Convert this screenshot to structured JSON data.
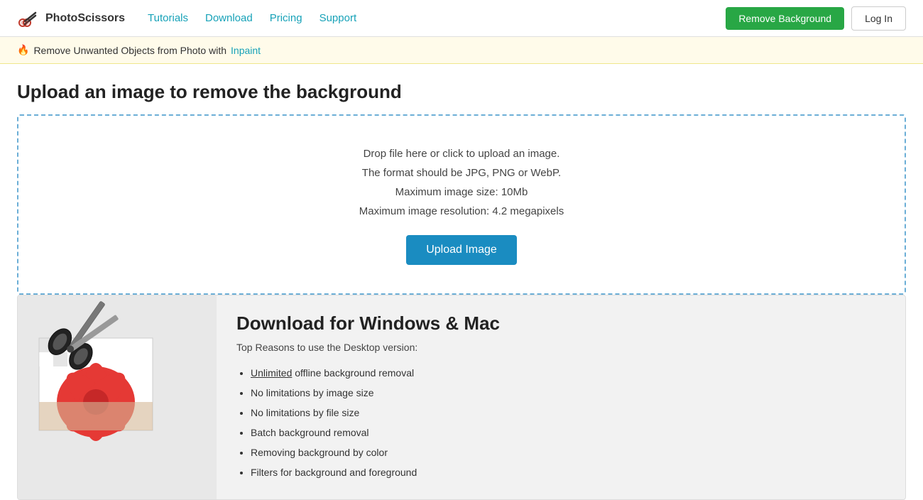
{
  "header": {
    "logo_text": "PhotoScissors",
    "nav": [
      {
        "label": "Tutorials",
        "href": "#"
      },
      {
        "label": "Download",
        "href": "#"
      },
      {
        "label": "Pricing",
        "href": "#"
      },
      {
        "label": "Support",
        "href": "#"
      }
    ],
    "remove_bg_label": "Remove Background",
    "login_label": "Log In"
  },
  "notice": {
    "text": "Remove Unwanted Objects from Photo with",
    "link_text": "Inpaint",
    "link_href": "#"
  },
  "page_title": "Upload an image to remove the background",
  "upload": {
    "line1": "Drop file here or click to upload an image.",
    "line2": "The format should be JPG, PNG or WebP.",
    "line3": "Maximum image size: 10Mb",
    "line4": "Maximum image resolution: 4.2 megapixels",
    "button_label": "Upload Image"
  },
  "download_section": {
    "title": "Download for Windows & Mac",
    "subtitle": "Top Reasons to use the Desktop version:",
    "features": [
      {
        "text": "Unlimited",
        "underline": true,
        "rest": " offline background removal"
      },
      {
        "text": "No limitations by image size",
        "underline": false,
        "rest": ""
      },
      {
        "text": "No limitations by file size",
        "underline": false,
        "rest": ""
      },
      {
        "text": "Batch background removal",
        "underline": false,
        "rest": ""
      },
      {
        "text": "Removing background by color",
        "underline": false,
        "rest": ""
      },
      {
        "text": "Filters for background and foreground",
        "underline": false,
        "rest": ""
      }
    ]
  }
}
